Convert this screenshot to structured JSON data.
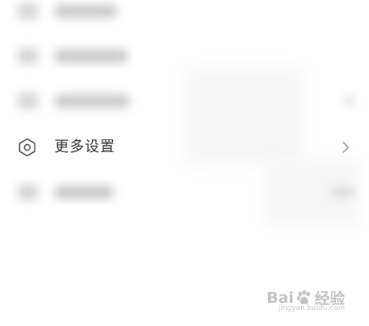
{
  "settings_list": {
    "more_settings": {
      "label": "更多设置",
      "icon": "hexagon-settings-icon",
      "chevron": "chevron-right-icon"
    }
  },
  "watermark": {
    "brand": "Bai",
    "brand_cn": "经验",
    "url": "jingyan.baidu.com"
  },
  "colors": {
    "background": "#ffffff",
    "label_text": "#333333",
    "icon_stroke": "#555555",
    "chevron": "#9a9a9a",
    "watermark": "#c2c2c2"
  }
}
